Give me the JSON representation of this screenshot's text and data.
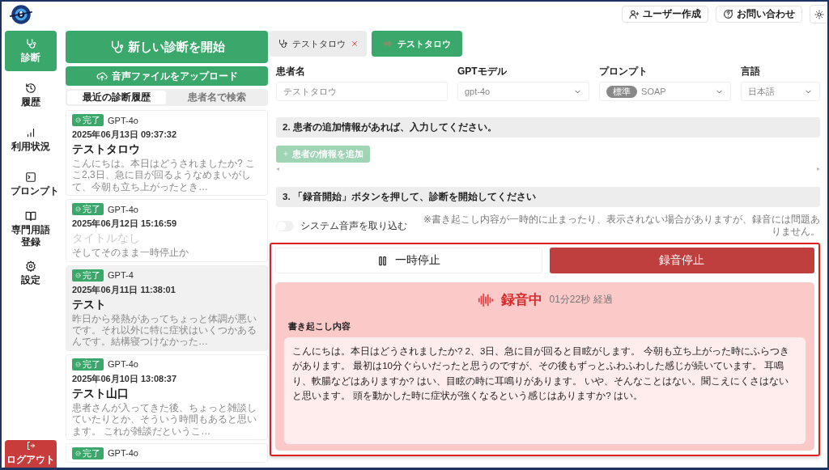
{
  "header": {
    "buttons": [
      {
        "label": "ユーザー作成",
        "kind": "user-add"
      },
      {
        "label": "お問い合わせ",
        "kind": "help"
      }
    ]
  },
  "sidebar": {
    "items": [
      {
        "label": "診断",
        "kind": "stethoscope",
        "selected": true
      },
      {
        "label": "履歴",
        "kind": "history",
        "selected": false
      },
      {
        "label": "利用状況",
        "kind": "chart",
        "selected": false
      },
      {
        "label": "プロンプト",
        "kind": "terminal",
        "selected": false
      },
      {
        "label": "専門用語登録",
        "kind": "book",
        "selected": false
      },
      {
        "label": "設定",
        "kind": "gear",
        "selected": false
      }
    ],
    "logout": "ログアウト"
  },
  "history": {
    "new_button": "新しい診断を開始",
    "upload_button": "音声ファイルをアップロード",
    "tabs": [
      {
        "label": "最近の診断履歴",
        "selected": true
      },
      {
        "label": "患者名で検索",
        "selected": false
      }
    ],
    "cards": [
      {
        "status": "完了",
        "model": "GPT-4o",
        "date": "2025年06月13日 09:37:32",
        "title": "テストタロウ",
        "untitled": false,
        "excerpt": "こんにちは。本日はどうされましたか? ここ2,3日、急に目が回るようなめまいがして、今朝も立ち上がったとき…",
        "selected": false
      },
      {
        "status": "完了",
        "model": "GPT-4o",
        "date": "2025年06月12日 15:16:59",
        "title": "タイトルなし",
        "untitled": true,
        "excerpt": "そしてそのまま一時停止か",
        "selected": false
      },
      {
        "status": "完了",
        "model": "GPT-4",
        "date": "2025年06月11日 11:38:01",
        "title": "テスト",
        "untitled": false,
        "excerpt": "昨日から発熱があってちょっと体調が悪いです。それ以外に特に症状はいくつかあるんです。結構寝つけなかった…",
        "selected": true
      },
      {
        "status": "完了",
        "model": "GPT-4o",
        "date": "2025年06月10日 13:08:37",
        "title": "テスト山口",
        "untitled": false,
        "excerpt": "患者さんが入ってきた後、ちょっと雑談していたりとか、そういう時間もあると思います。 これが雑談だというこ…",
        "selected": false
      },
      {
        "status": "完了",
        "model": "GPT-4o",
        "selected": false
      }
    ]
  },
  "sessions": [
    {
      "label": "テストタロウ",
      "selected": false
    },
    {
      "label": "テストタロウ",
      "selected": true
    }
  ],
  "fields": [
    {
      "label": "患者名",
      "kind": "text",
      "value": "テストタロウ",
      "disabled": true
    },
    {
      "label": "GPTモデル",
      "kind": "select",
      "value": "gpt-4o",
      "disabled": true
    },
    {
      "label": "プロンプト",
      "kind": "select",
      "tag": "標準",
      "value": "SOAP",
      "disabled": true
    },
    {
      "label": "言語",
      "kind": "select",
      "value": "日本語",
      "disabled": true
    }
  ],
  "section2": {
    "title": "2. 患者の追加情報があれば、入力してください。",
    "add_button": "患者の情報を追加",
    "add_disabled": true
  },
  "section3": {
    "title": "3. 「録音開始」ボタンを押して、診断を開始してください",
    "system_audio": {
      "label": "システム音声を取り込む",
      "on": false
    },
    "note": "※書き起こし内容が一時的に止まったり、表示されない場合がありますが、録音には問題ありません。"
  },
  "recording": {
    "pause_button": "一時停止",
    "stop_button": "録音停止",
    "status": "録音中",
    "elapsed": "01分22秒 経過",
    "transcript_label": "書き起こし内容",
    "transcript": "こんにちは。本日はどうされましたか? 2、3日、急に目が回ると目眩がします。 今朝も立ち上がった時にふらつきがあります。 最初は10分ぐらいだったと思うのですが、その後もずっとふわふわした感じが続いています。 耳鳴り、軟腸などはありますか? はい、目眩の時に耳鳴りがあります。 いや、そんなことはない。聞こえにくさはないと思います。 頭を動かした時に症状が強くなるという感じはありますか? はい。"
  }
}
